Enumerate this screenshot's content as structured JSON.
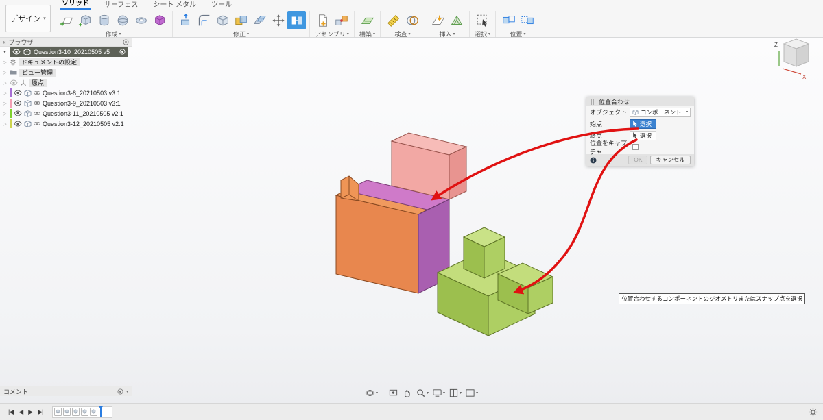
{
  "menu": {
    "design_label": "デザイン"
  },
  "tabs": [
    {
      "label": "ソリッド",
      "active": true
    },
    {
      "label": "サーフェス",
      "active": false
    },
    {
      "label": "シート メタル",
      "active": false
    },
    {
      "label": "ツール",
      "active": false
    }
  ],
  "ribbon": {
    "groups": [
      {
        "label": "作成",
        "icons": [
          "create-sketch",
          "primitive-box",
          "primitive-cylinder",
          "primitive-sphere",
          "primitive-torus",
          "create-form"
        ]
      },
      {
        "label": "修正",
        "icons": [
          "press-pull",
          "fillet",
          "shell",
          "combine",
          "offset-face",
          "move-copy",
          "align"
        ],
        "active_tool": "align"
      },
      {
        "label": "アセンブリ",
        "icons": [
          "new-component",
          "joint"
        ]
      },
      {
        "label": "構築",
        "icons": [
          "construction-plane"
        ]
      },
      {
        "label": "検査",
        "icons": [
          "measure",
          "interference"
        ]
      },
      {
        "label": "挿入",
        "icons": [
          "insert-canvas",
          "insert-mesh"
        ]
      },
      {
        "label": "選択",
        "icons": [
          "select"
        ]
      },
      {
        "label": "位置",
        "icons": [
          "capture-position",
          "revert-position"
        ]
      }
    ]
  },
  "browser": {
    "title": "ブラウザ",
    "root": {
      "label": "Question3-10_20210505 v5"
    },
    "items": [
      {
        "label": "ドキュメントの設定"
      },
      {
        "label": "ビュー管理"
      },
      {
        "label": "原点"
      },
      {
        "label": "Question3-8_20210503 v3:1",
        "color": "#a86fd4"
      },
      {
        "label": "Question3-9_20210503 v3:1",
        "color": "#f2a0b4"
      },
      {
        "label": "Question3-11_20210505 v2:1",
        "color": "#7fd12e"
      },
      {
        "label": "Question3-12_20210505 v2:1",
        "color": "#cdd44e"
      }
    ]
  },
  "viewcube": {
    "z_label": "Z",
    "x_label": "X"
  },
  "dialog": {
    "title": "位置合わせ",
    "object_label": "オブジェクト",
    "object_value": "コンポーネント",
    "start_label": "始点",
    "start_button": "選択",
    "end_label": "終点",
    "end_button": "選択",
    "capture_label": "位置をキャプチャ",
    "ok_label": "OK",
    "cancel_label": "キャンセル"
  },
  "tooltip": "位置合わせするコンポーネントのジオメトリまたはスナップ点を選択",
  "comment": {
    "label": "コメント"
  },
  "colors": {
    "accent_blue": "#3f97e0",
    "selection_blue": "#3b82d0",
    "arrow_red": "#e01212",
    "model_orange": "#e8874e",
    "model_magenta": "#cf7ac9",
    "model_purple": "#a95fb0",
    "model_salmon": "#f2a8a4",
    "model_green": "#9cbf4e"
  }
}
